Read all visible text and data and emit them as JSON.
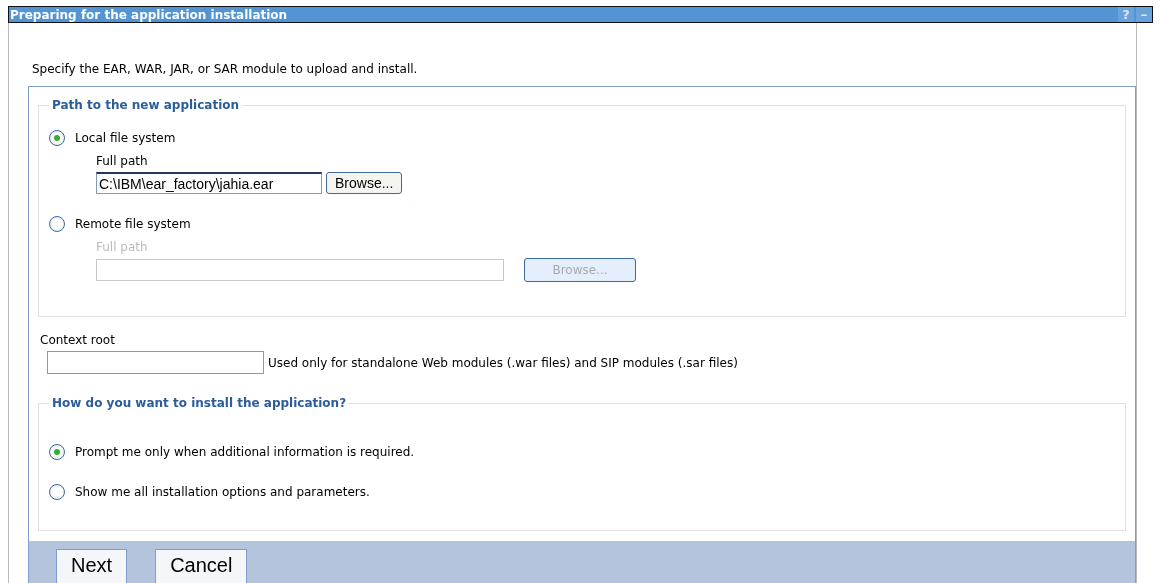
{
  "window": {
    "title": "Preparing for the application installation",
    "help": "?",
    "minimize": "–"
  },
  "intro": "Specify the EAR, WAR, JAR, or SAR module to upload and install.",
  "path_group": {
    "legend": "Path to the new application",
    "options": [
      {
        "label": "Local file system",
        "selected": true,
        "field_label": "Full path",
        "value": "C:\\IBM\\ear_factory\\jahia.ear",
        "button": "Browse...",
        "disabled": false
      },
      {
        "label": "Remote file system",
        "selected": false,
        "field_label": "Full path",
        "button": "Browse...",
        "disabled": true
      }
    ]
  },
  "context_root": {
    "label": "Context root",
    "hint": "Used only for standalone Web modules (.war files) and SIP modules (.sar files)"
  },
  "install_group": {
    "legend": "How do you want to install the application?",
    "options": [
      {
        "label": "Prompt me only when additional information is required.",
        "selected": true
      },
      {
        "label": "Show me all installation options and parameters.",
        "selected": false
      }
    ]
  },
  "buttons": [
    "Next",
    "Cancel"
  ]
}
